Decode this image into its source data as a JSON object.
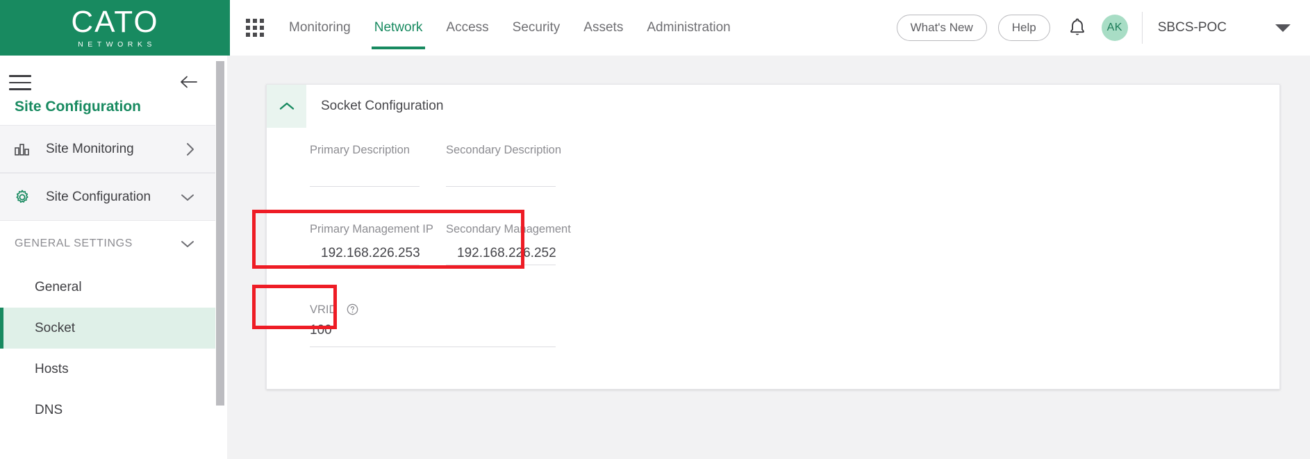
{
  "brand": {
    "logo_text": "CATO",
    "logo_subtext": "NETWORKS",
    "green": "#188a60",
    "highlight_red": "#ee1c25"
  },
  "topnav": {
    "apps_icon": "grid-apps-icon",
    "items": [
      {
        "label": "Monitoring",
        "active": false
      },
      {
        "label": "Network",
        "active": true
      },
      {
        "label": "Access",
        "active": false
      },
      {
        "label": "Security",
        "active": false
      },
      {
        "label": "Assets",
        "active": false
      },
      {
        "label": "Administration",
        "active": false
      }
    ],
    "whats_new_label": "What's New",
    "help_label": "Help",
    "notifications_icon": "bell-icon",
    "avatar_initials": "AK",
    "account_name": "SBCS-POC",
    "account_caret_icon": "caret-down-icon"
  },
  "sidebar": {
    "menu_icon": "hamburger-menu-icon",
    "back_icon": "arrow-left-icon",
    "title": "Site Configuration",
    "rows": [
      {
        "label": "Site Monitoring",
        "icon": "bar-chart-icon",
        "chevron": "chevron-right-icon"
      },
      {
        "label": "Site Configuration",
        "icon": "gear-icon",
        "chevron": "chevron-down-icon"
      }
    ],
    "section": {
      "label": "GENERAL SETTINGS",
      "chevron": "chevron-down-icon"
    },
    "sub_items": [
      {
        "label": "General",
        "selected": false
      },
      {
        "label": "Socket",
        "selected": true
      },
      {
        "label": "Hosts",
        "selected": false
      },
      {
        "label": "DNS",
        "selected": false
      }
    ]
  },
  "main": {
    "card": {
      "title": "Socket Configuration",
      "collapse_icon": "chevron-up-icon",
      "fields": {
        "primary_description": {
          "label": "Primary Description",
          "value": ""
        },
        "secondary_description": {
          "label": "Secondary Description",
          "value": ""
        },
        "primary_management_ip": {
          "label": "Primary Management IP",
          "value": "192.168.226.253",
          "icon": "location-pin-icon"
        },
        "secondary_management_ip": {
          "label": "Secondary Management",
          "value": "192.168.226.252",
          "icon": "location-pin-icon"
        },
        "vrid": {
          "label": "VRID",
          "value": "100",
          "help_icon": "help-circle-icon"
        }
      }
    }
  }
}
